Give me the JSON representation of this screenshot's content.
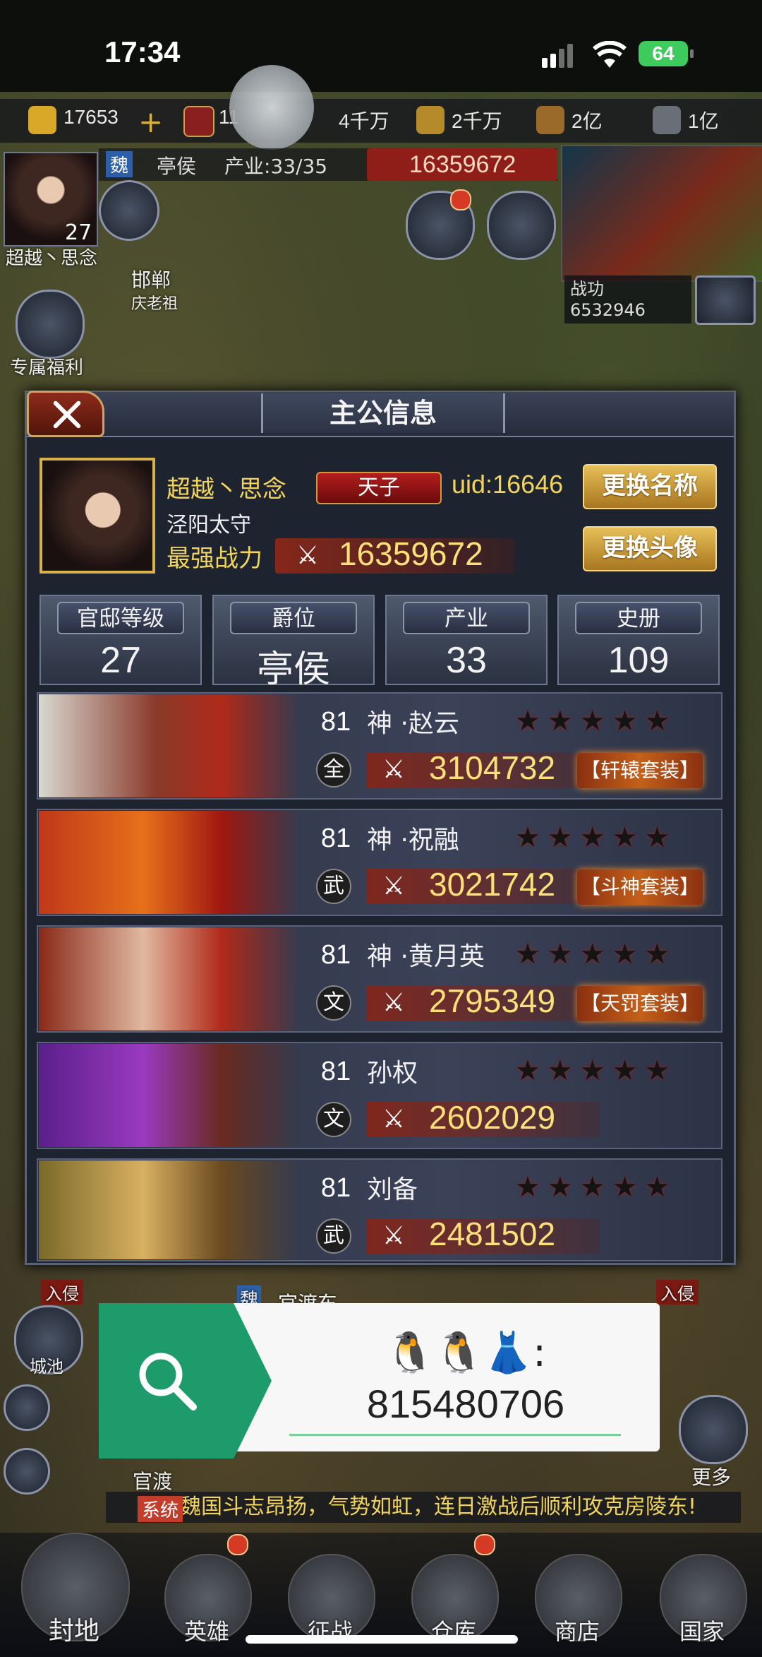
{
  "status_bar": {
    "time": "17:34",
    "battery": "64"
  },
  "resources": {
    "gold": "17653",
    "level": "11",
    "r1": "4千万",
    "r2": "2千万",
    "r3": "2亿",
    "r4": "1亿"
  },
  "sub_bar": {
    "faction": "魏",
    "rank": "亭侯",
    "industry": "产业:33/35",
    "combat": "16359672"
  },
  "left_panel": {
    "player_name": "超越丶思念",
    "player_level": "27",
    "city_name": "邯郸",
    "city_owner": "庆老祖",
    "welfare": "专属福利"
  },
  "minimap": {
    "label": "战功",
    "value": "6532946"
  },
  "dialog": {
    "title": "主公信息",
    "name": "超越丶思念",
    "title_badge": "天子",
    "uid": "uid:16646",
    "office": "泾阳太守",
    "power_label": "最强战力",
    "power": "16359672",
    "rename_button": "更换名称",
    "avatar_button": "更换头像",
    "stats": [
      {
        "label": "官邸等级",
        "value": "27"
      },
      {
        "label": "爵位",
        "value": "亭侯"
      },
      {
        "label": "产业",
        "value": "33"
      },
      {
        "label": "史册",
        "value": "109"
      }
    ],
    "heroes": [
      {
        "level": "81",
        "name": "神 ·赵云",
        "type": "全",
        "power": "3104732",
        "set": "【轩辕套装】",
        "stars": "★★★★★"
      },
      {
        "level": "81",
        "name": "神 ·祝融",
        "type": "武",
        "power": "3021742",
        "set": "【斗神套装】",
        "stars": "★★★★★"
      },
      {
        "level": "81",
        "name": "神 ·黄月英",
        "type": "文",
        "power": "2795349",
        "set": "【天罚套装】",
        "stars": "★★★★★"
      },
      {
        "level": "81",
        "name": "孙权",
        "type": "文",
        "power": "2602029",
        "set": "",
        "stars": "★★★★★"
      },
      {
        "level": "81",
        "name": "刘备",
        "type": "武",
        "power": "2481502",
        "set": "",
        "stars": "★★★★★"
      }
    ]
  },
  "map_labels": {
    "invade_left": "入侵",
    "invade_right": "入侵",
    "guandu_east": "官渡东",
    "guandu": "官渡",
    "city": "城池",
    "faction_tag": "魏",
    "more": "更多"
  },
  "overlay": {
    "qq_line": "🐧🐧👗:",
    "qq_number": "815480706"
  },
  "marquee": {
    "tag": "系统",
    "text": "魏国斗志昂扬，气势如虹，连日激战后顺利攻克房陵东!"
  },
  "nav": [
    "封地",
    "英雄",
    "征战",
    "仓库",
    "商店",
    "国家"
  ],
  "colors": {
    "accent_gold": "#f2d45c",
    "dialog_bg": "#1d2430",
    "overlay_green": "#1e9b6a",
    "close_red": "#8e2b1c"
  }
}
